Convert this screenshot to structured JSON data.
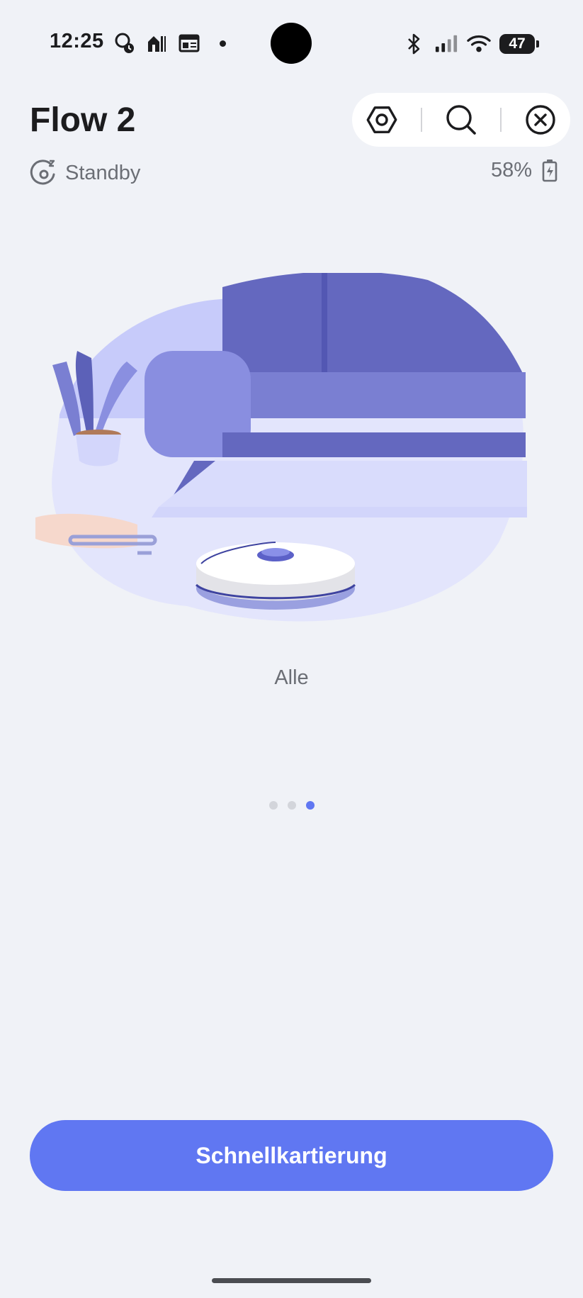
{
  "status_bar": {
    "time": "12:25",
    "battery_level": "47",
    "left_icons": [
      "app-notification-icon",
      "food-delivery-icon",
      "news-icon"
    ],
    "right_icons": [
      "bluetooth-icon",
      "signal-icon",
      "wifi-icon"
    ]
  },
  "header": {
    "title": "Flow 2",
    "actions": [
      "settings-icon",
      "search-icon",
      "close-icon"
    ]
  },
  "device": {
    "status": "Standby",
    "battery": "58%",
    "status_icon": "sleep-icon",
    "battery_icon": "battery-charging-icon"
  },
  "slide": {
    "caption": "Alle",
    "page_count": 3,
    "active_page": 3
  },
  "actions": {
    "primary_label": "Schnellkartierung"
  },
  "colors": {
    "accent": "#6077f2",
    "background": "#f0f2f7",
    "text_secondary": "#6b6e75"
  }
}
